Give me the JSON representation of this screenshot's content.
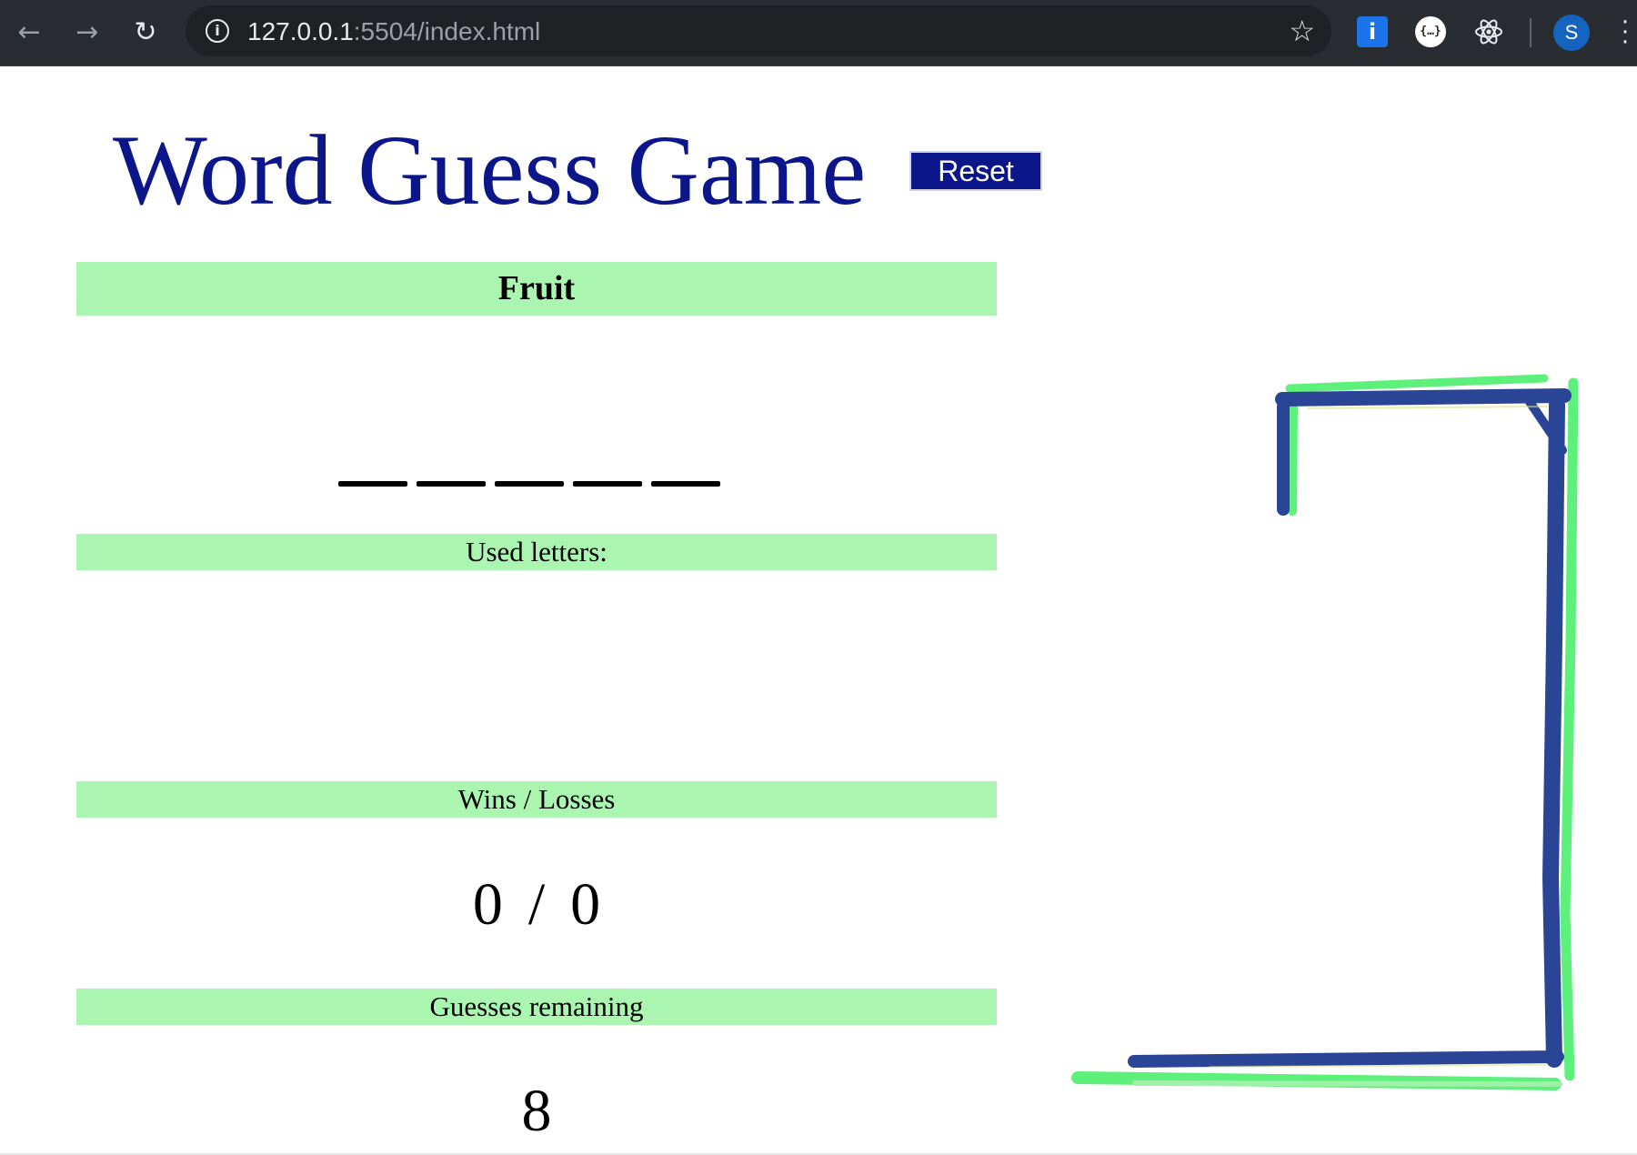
{
  "browser": {
    "url_host": "127.0.0.1",
    "url_rest": ":5504/index.html",
    "avatar_initial": "S",
    "icons": [
      "back-arrow-icon",
      "forward-arrow-icon",
      "reload-icon",
      "info-icon",
      "star-icon",
      "extension-info-icon",
      "json-viewer-icon",
      "react-devtools-icon",
      "menu-dots-icon"
    ]
  },
  "page": {
    "title": "Word Guess Game",
    "reset_label": "Reset",
    "category": "Fruit",
    "word_blanks": [
      "",
      "",
      "",
      "",
      ""
    ],
    "used_letters_label": "Used letters:",
    "used_letters": "",
    "wins_losses_label": "Wins / Losses",
    "wins": "0",
    "losses": "0",
    "score_separator": "/",
    "guesses_label": "Guesses remaining",
    "guesses_remaining": "8"
  },
  "colors": {
    "title": "#0b168a",
    "band": "#aaf6b0",
    "gallows_blue": "#2a4596",
    "gallows_green": "#5df07a"
  }
}
